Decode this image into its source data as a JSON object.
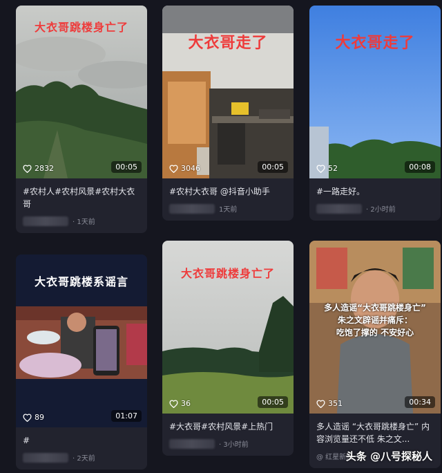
{
  "cards": [
    {
      "overlay": "大衣哥跳楼身亡了",
      "likes": "2832",
      "duration": "00:05",
      "caption": "#农村人#农村风景#农村大衣哥",
      "time": "· 1天前"
    },
    {
      "overlay": "大衣哥走了",
      "likes": "3046",
      "duration": "00:05",
      "caption": "#农村大衣哥 @抖音小助手",
      "time": "1天前"
    },
    {
      "overlay": "大衣哥走了",
      "likes": "52",
      "duration": "00:08",
      "caption": "#一路走好。",
      "time": "· 2小时前"
    },
    {
      "overlay": "大衣哥跳楼系谣言",
      "likes": "89",
      "duration": "01:07",
      "caption": "#",
      "time": "· 2天前"
    },
    {
      "overlay": "大衣哥跳楼身亡了",
      "likes": "36",
      "duration": "00:05",
      "caption": "#大衣哥#农村风景#上热门",
      "time": "· 3小时前"
    },
    {
      "overlay_lines": [
        "多人造谣“大衣哥跳楼身亡”",
        "朱之文辟谣并痛斥：",
        "吃饱了撑的  不安好心"
      ],
      "likes": "351",
      "duration": "00:34",
      "caption": "多人造谣 “大衣哥跳楼身亡” 内容浏览量还不低 朱之文...",
      "time": "@ 红星新闻"
    }
  ],
  "watermark": "头条 @八号探秘人",
  "colors": {
    "background": "#15161f",
    "card": "#22232e",
    "overlay_red": "#ee3b3b"
  },
  "icons": {
    "likes": "heart-icon"
  }
}
